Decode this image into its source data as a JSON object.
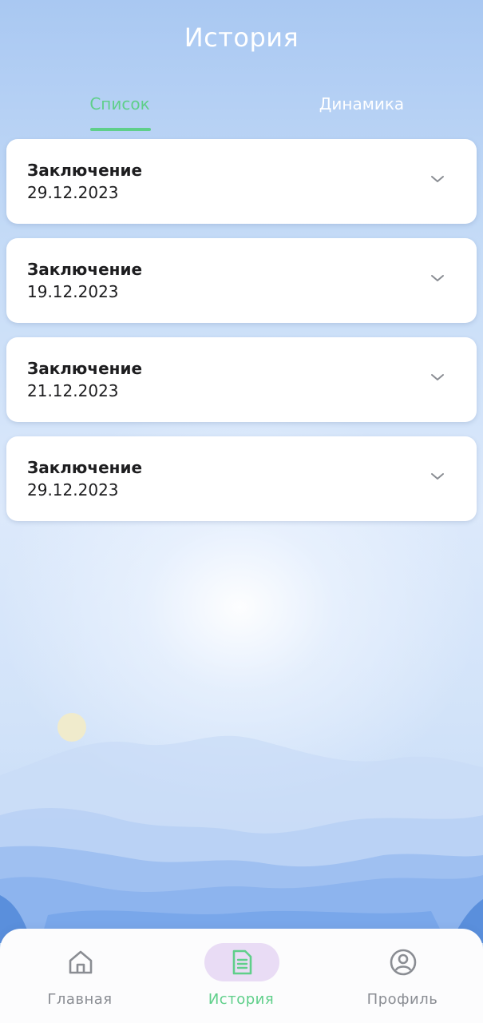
{
  "header": {
    "title": "История"
  },
  "tabs": [
    {
      "label": "Список",
      "active": true
    },
    {
      "label": "Динамика",
      "active": false
    }
  ],
  "records": [
    {
      "title": "Заключение",
      "date": "29.12.2023"
    },
    {
      "title": "Заключение",
      "date": "19.12.2023"
    },
    {
      "title": "Заключение",
      "date": "21.12.2023"
    },
    {
      "title": "Заключение",
      "date": "29.12.2023"
    }
  ],
  "bottom_nav": [
    {
      "label": "Главная",
      "icon": "home-icon",
      "active": false
    },
    {
      "label": "История",
      "icon": "document-icon",
      "active": true
    },
    {
      "label": "Профиль",
      "icon": "profile-icon",
      "active": false
    }
  ],
  "colors": {
    "accent": "#5fcf8a",
    "active_nav_bg": "#e9dcf5",
    "inactive_text": "#8a8d93"
  }
}
